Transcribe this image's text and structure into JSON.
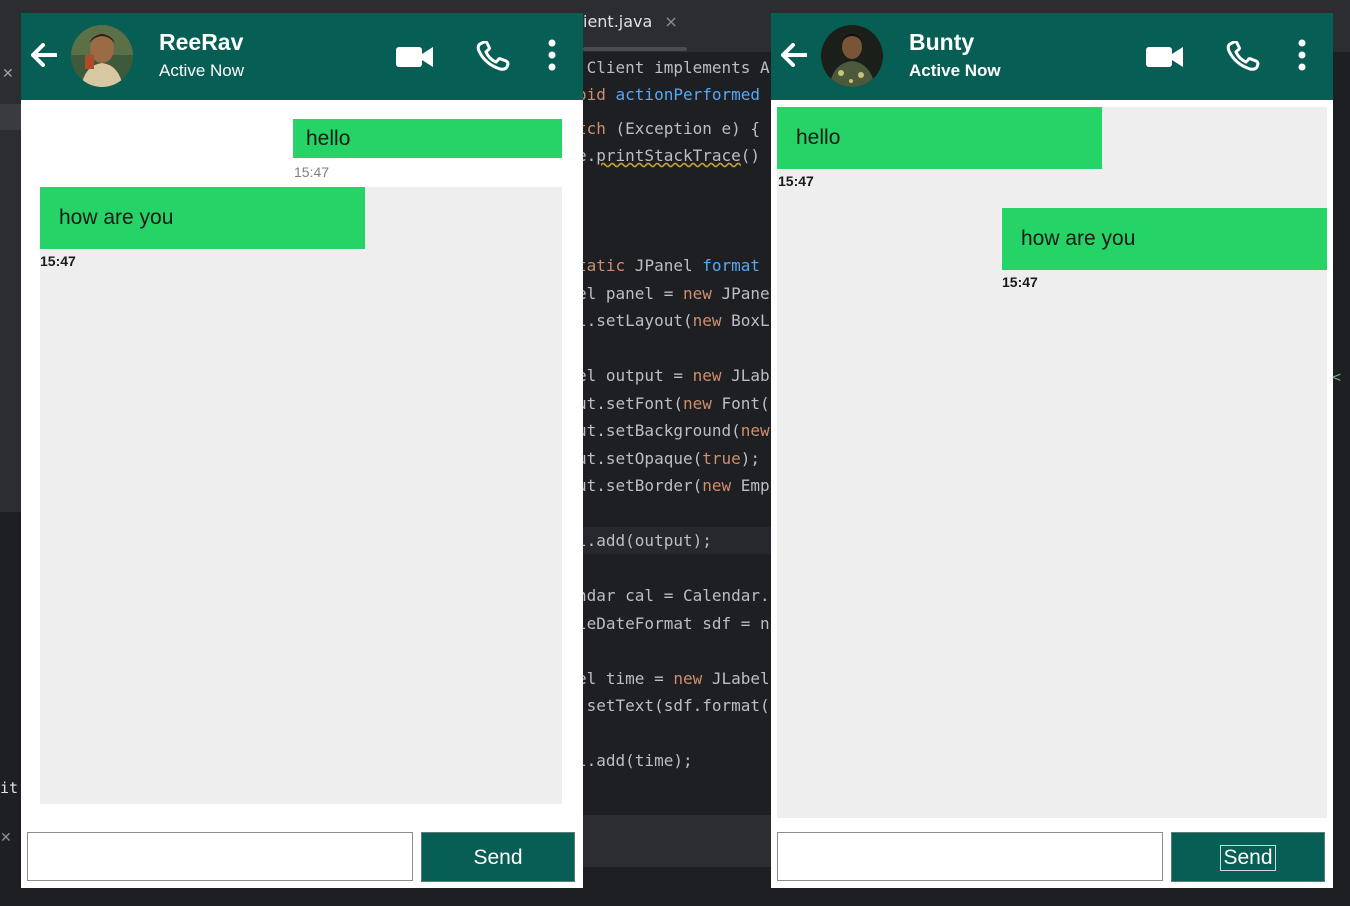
{
  "ide": {
    "tab_label": "ient.java",
    "tab_close": "×",
    "left_fragment": "it a",
    "right_fragment": "<"
  },
  "left_chat": {
    "contact_name": "ReeRav",
    "status": "Active Now",
    "messages": [
      {
        "text": "hello",
        "time": "15:47",
        "direction": "sent"
      },
      {
        "text": "how are you",
        "time": "15:47",
        "direction": "received"
      }
    ],
    "input_value": "",
    "send_label": "Send"
  },
  "right_chat": {
    "contact_name": "Bunty",
    "status": "Active Now",
    "messages": [
      {
        "text": "hello",
        "time": "15:47",
        "direction": "received"
      },
      {
        "text": "how are you",
        "time": "15:47",
        "direction": "sent"
      }
    ],
    "input_value": "",
    "send_label": "Send"
  },
  "code_lines": [
    {
      "t": " Client implements A"
    },
    {
      "t": "oid actionPerformed"
    },
    {
      "t": "tch (Exception e) {"
    },
    {
      "t": "e.printStackTrace()"
    },
    {
      "t": "tatic JPanel format"
    },
    {
      "t": "el panel = new JPane"
    },
    {
      "t": "l.setLayout(new BoxL"
    },
    {
      "t": "el output = new JLab"
    },
    {
      "t": "ut.setFont(new Font("
    },
    {
      "t": "ut.setBackground(new"
    },
    {
      "t": "ut.setOpaque(true);"
    },
    {
      "t": "ut.setBorder(new Emp"
    },
    {
      "t": "l.add(output);"
    },
    {
      "t": "ndar cal = Calendar."
    },
    {
      "t": "leDateFormat sdf = n"
    },
    {
      "t": "el time = new JLabel"
    },
    {
      "t": ".setText(sdf.format("
    },
    {
      "t": "l.add(time);"
    }
  ],
  "colors": {
    "header": "#075e54",
    "bubble": "#25d366",
    "chat_bg": "#eeeeee",
    "ide_bg": "#1e1f22"
  }
}
